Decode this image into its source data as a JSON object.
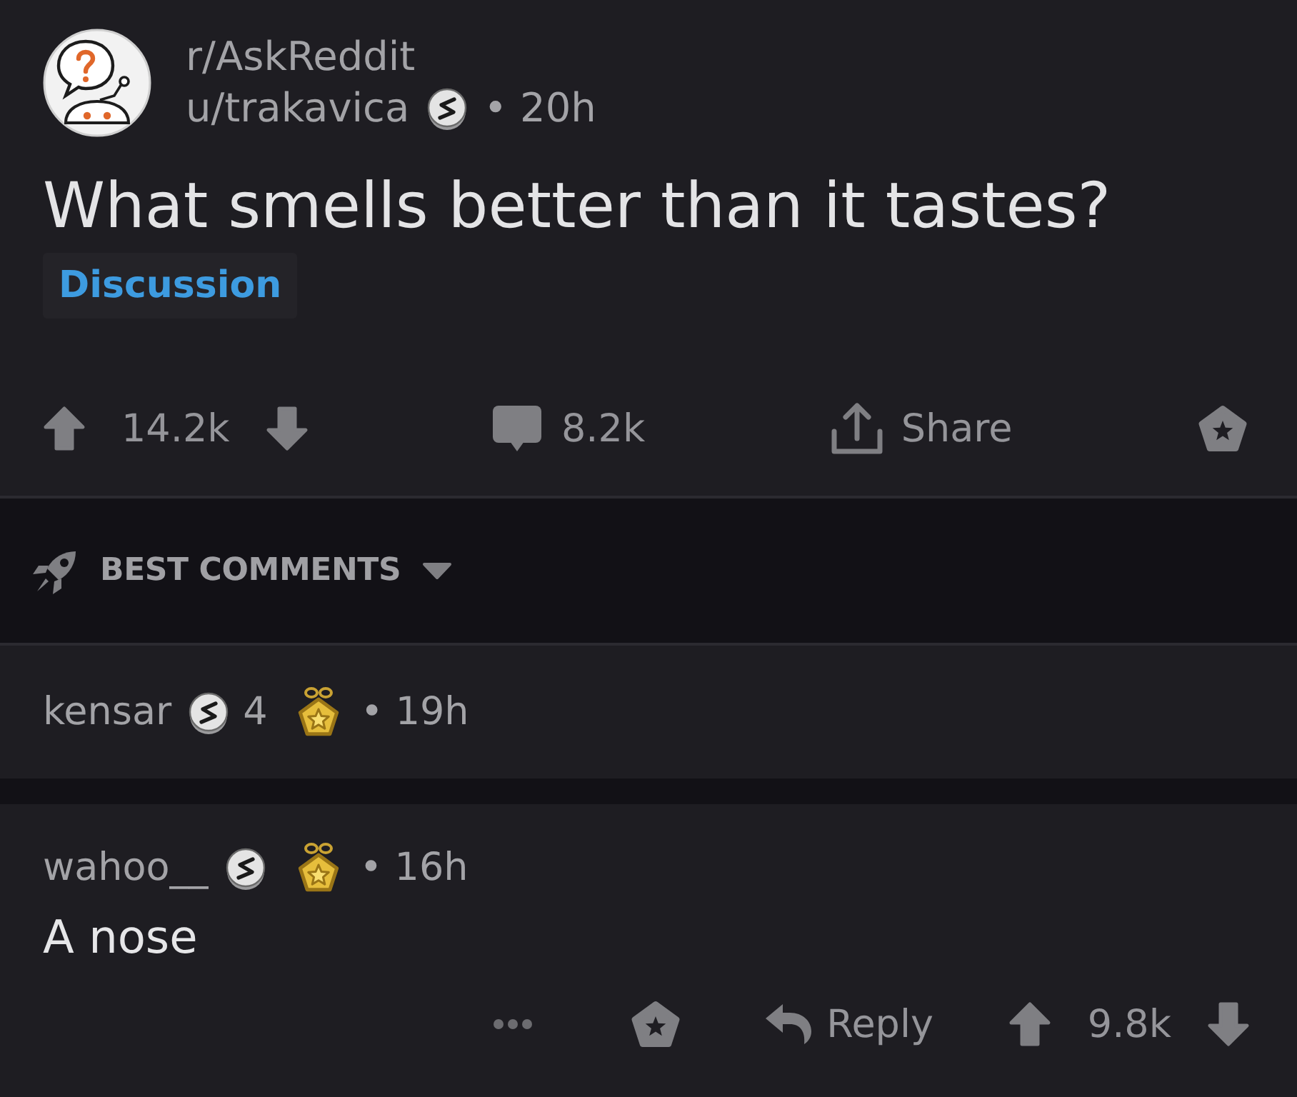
{
  "post": {
    "subreddit": "r/AskReddit",
    "author": "u/trakavica",
    "author_awards": [
      {
        "kind": "coin"
      }
    ],
    "time": "• 20h",
    "title": "What smells better than it tastes?",
    "flair": "Discussion",
    "score": "14.2k",
    "comment_count": "8.2k",
    "share_label": "Share"
  },
  "sort": {
    "label": "BEST COMMENTS"
  },
  "comments": [
    {
      "author": "kensar",
      "awards": [
        {
          "kind": "coin",
          "count": "4"
        },
        {
          "kind": "star"
        }
      ],
      "time": "• 19h"
    },
    {
      "author": "wahoo__",
      "awards": [
        {
          "kind": "coin"
        },
        {
          "kind": "star"
        }
      ],
      "time": "• 16h",
      "body": "A nose",
      "reply_label": "Reply",
      "score": "9.8k"
    }
  ]
}
